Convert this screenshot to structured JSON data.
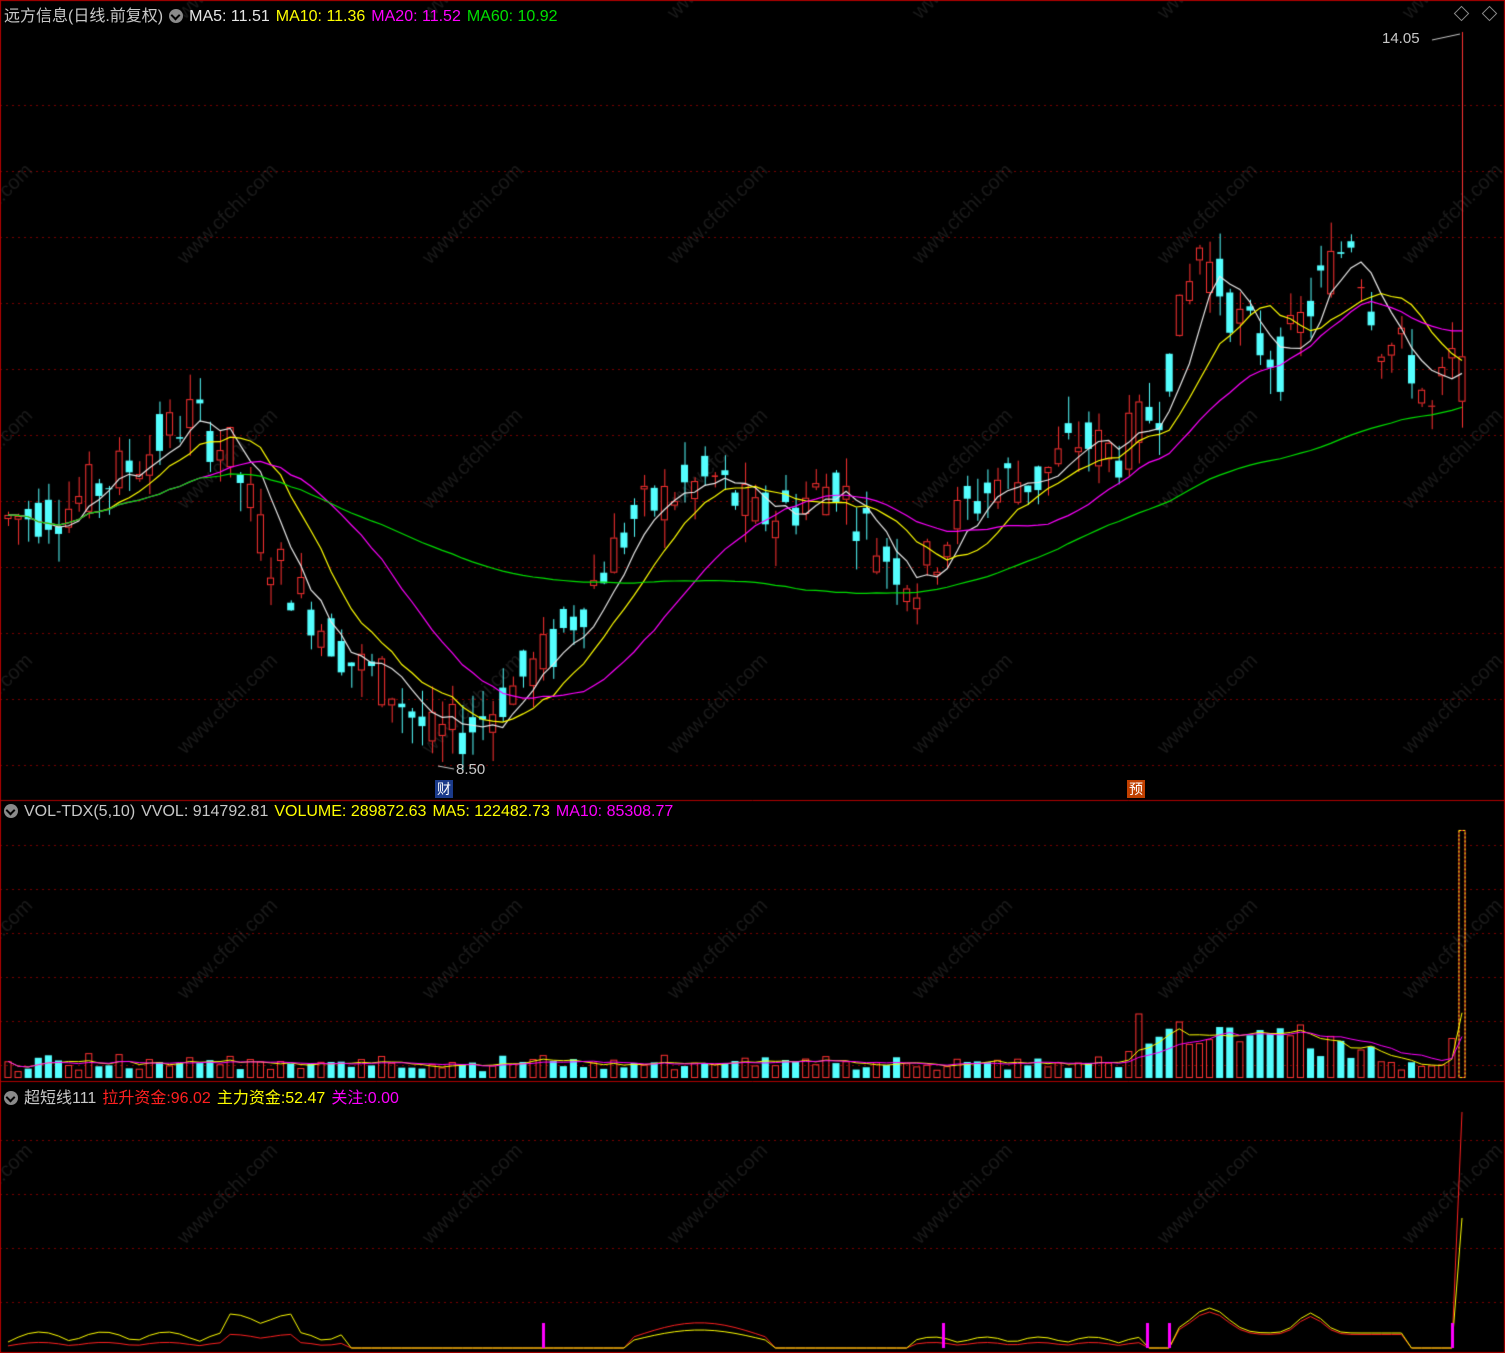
{
  "main_panel": {
    "stock_title": "远方信息(日线.前复权)",
    "indicators": [
      {
        "label": "MA5: 11.51",
        "color": "#e6e6e6"
      },
      {
        "label": "MA10: 11.36",
        "color": "#ffff00"
      },
      {
        "label": "MA20: 11.52",
        "color": "#ff00ff"
      },
      {
        "label": "MA60: 10.92",
        "color": "#00e000"
      }
    ],
    "high_price_label": "14.05",
    "low_price_label": "8.50",
    "marker_cai": "财",
    "marker_yu": "预"
  },
  "volume_panel": {
    "title": "VOL-TDX(5,10)",
    "vvol": "VVOL: 914792.81",
    "volume": "VOLUME: 289872.63",
    "ma5": "MA5: 122482.73",
    "ma10": "MA10: 85308.77",
    "colors": {
      "volume": "#ffff00",
      "ma5": "#ffff00",
      "ma10": "#ff00ff"
    }
  },
  "indicator_panel": {
    "title": "超短线111",
    "lasheng_label": "拉升资金:",
    "lasheng_value": "96.02",
    "zhuli_label": "主力资金:",
    "zhuli_value": "52.47",
    "guanzhu_label": "关注:",
    "guanzhu_value": "0.00",
    "colors": {
      "lasheng": "#ff2020",
      "zhuli": "#ffff00",
      "guanzhu": "#ff00ff"
    }
  },
  "colors": {
    "up": "#ff3232",
    "down": "#54ffff",
    "grid": "#7a0000",
    "border": "#b00000",
    "ma5": "#e6e6e6",
    "ma10": "#ffff00",
    "ma20": "#ff00ff",
    "ma60": "#00e000"
  },
  "watermark": "www.cfchi.com"
}
